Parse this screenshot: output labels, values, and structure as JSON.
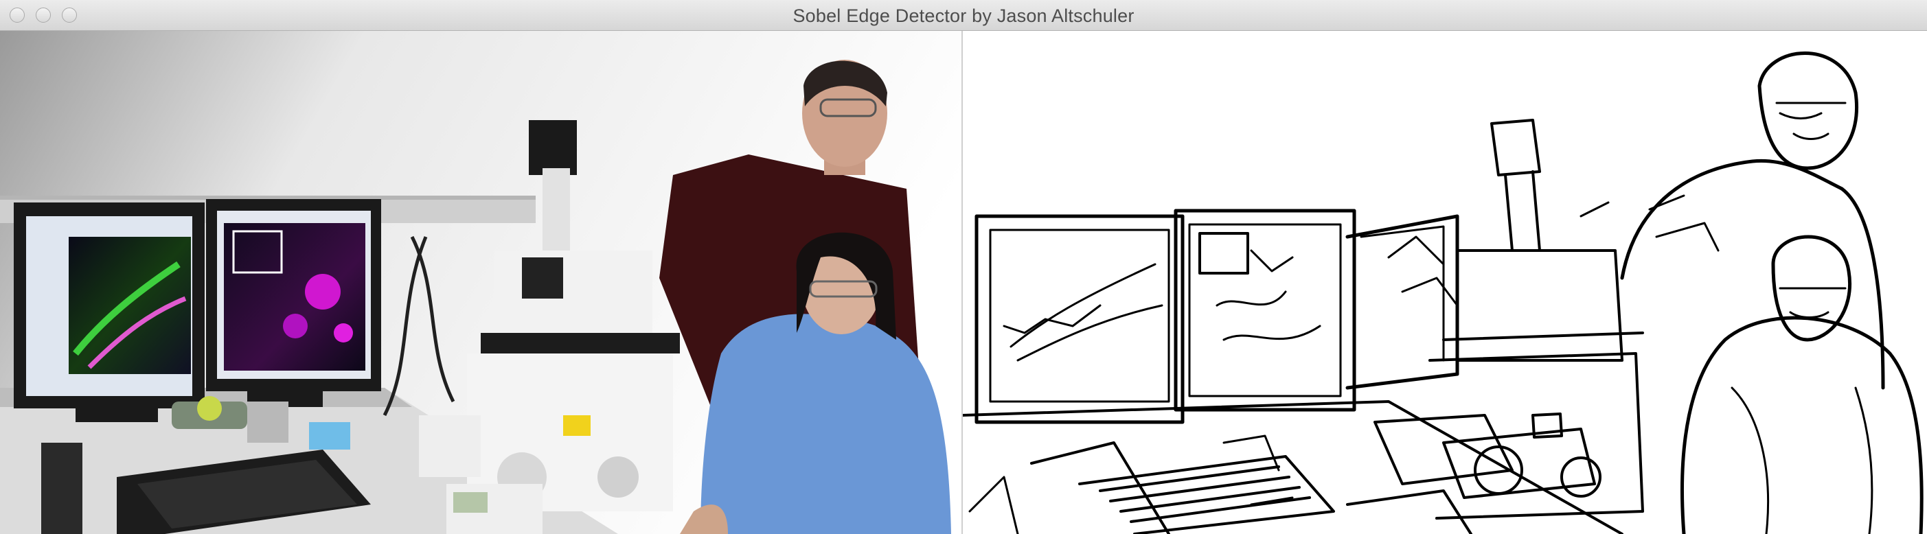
{
  "window": {
    "title": "Sobel Edge Detector by Jason Altschuler",
    "controls": [
      "close-button",
      "minimize-button",
      "zoom-button"
    ]
  },
  "panels": {
    "original": {
      "kind": "photo"
    },
    "edges": {
      "kind": "edge-map"
    }
  }
}
